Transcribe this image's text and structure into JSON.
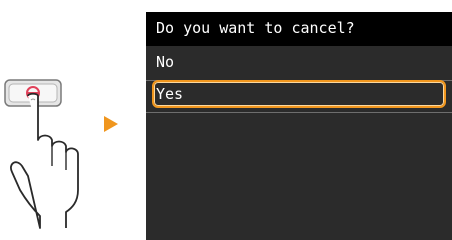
{
  "screen": {
    "title": "Do you want to cancel?",
    "options": [
      {
        "label": "No",
        "selected": false
      },
      {
        "label": "Yes",
        "selected": true
      }
    ]
  },
  "colors": {
    "accent": "#f0961e",
    "screen_bg": "#2b2b2b",
    "title_bg": "#000000",
    "text": "#ffffff"
  },
  "icons": {
    "hand": "hand-pressing-button-icon",
    "arrow": "arrow-right-icon"
  }
}
